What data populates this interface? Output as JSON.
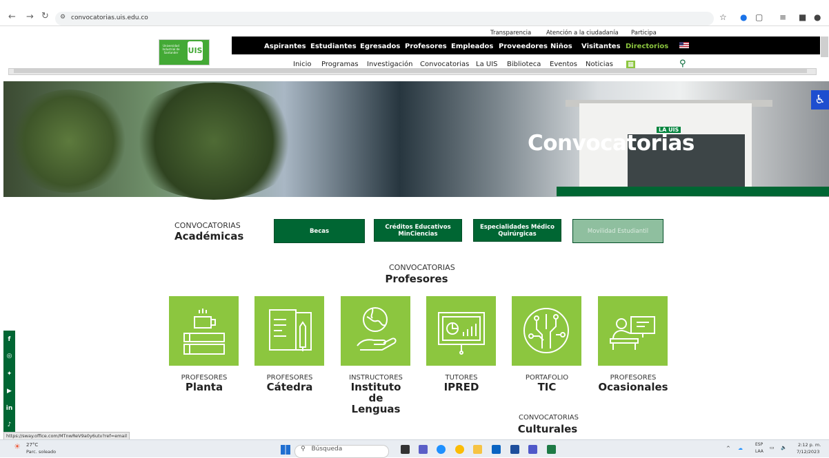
{
  "browser": {
    "url": "convocatorias.uis.edu.co"
  },
  "header": {
    "logo_text": "Universidad Industrial de Santander",
    "logo_mark": "UIS",
    "top_links": [
      "Transparencia",
      "Atención a la ciudadanía",
      "Participa"
    ],
    "main_nav": [
      "Aspirantes",
      "Estudiantes",
      "Egresados",
      "Profesores",
      "Empleados",
      "Proveedores",
      "Niños",
      "Visitantes",
      "Directorios"
    ],
    "secondary_nav": [
      "Inicio",
      "Programas",
      "Investigación",
      "Convocatorias",
      "La UIS",
      "Biblioteca",
      "Eventos",
      "Noticias"
    ]
  },
  "banner": {
    "badge": "LA UIS",
    "title": "Convocatorias"
  },
  "academicas": {
    "small": "CONVOCATORIAS",
    "big": "Académicas",
    "buttons": [
      "Becas",
      "Créditos Educativos MinCiencias",
      "Especialidades Médico Quirúrgicas",
      "Movilidad Estudiantil"
    ]
  },
  "profesores": {
    "small": "CONVOCATORIAS",
    "big": "Profesores",
    "cards": [
      {
        "small": "PROFESORES",
        "big": "Planta",
        "icon": "coffee-books-icon"
      },
      {
        "small": "PROFESORES",
        "big": "Cátedra",
        "icon": "book-pen-icon"
      },
      {
        "small": "INSTRUCTORES",
        "big": "Instituto de Lenguas",
        "icon": "globe-hand-icon"
      },
      {
        "small": "TUTORES",
        "big": "IPRED",
        "icon": "presentation-chart-icon"
      },
      {
        "small": "PORTAFOLIO",
        "big": "TIC",
        "icon": "circuit-icon"
      },
      {
        "small": "PROFESORES",
        "big": "Ocasionales",
        "icon": "teacher-board-icon"
      }
    ]
  },
  "culturales": {
    "small": "CONVOCATORIAS",
    "big": "Culturales"
  },
  "status_link": "https://sway.office.com/MTnwReV9a0y6utv?ref=email",
  "taskbar": {
    "weather_temp": "27°C",
    "weather_desc": "Parc. soleado",
    "search_placeholder": "Búsqueda",
    "lang": "ESP",
    "lang2": "LAA",
    "time": "2:12 p. m.",
    "date": "7/12/2023"
  }
}
